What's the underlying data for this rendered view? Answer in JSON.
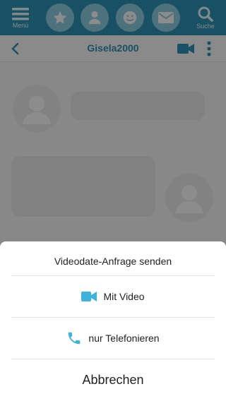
{
  "nav": {
    "menu_label": "Menü",
    "search_label": "Suche"
  },
  "chat": {
    "title": "Gisela2000"
  },
  "sheet": {
    "title": "Videodate-Anfrage senden",
    "options": [
      {
        "label": "Mit Video",
        "icon": "video-camera-icon"
      },
      {
        "label": "nur Telefonieren",
        "icon": "phone-icon"
      }
    ],
    "cancel_label": "Abbrechen"
  },
  "colors": {
    "accent": "#2e94b6",
    "icon_blue": "#3cb2dc",
    "nav_circle": "#8fd0e4"
  }
}
